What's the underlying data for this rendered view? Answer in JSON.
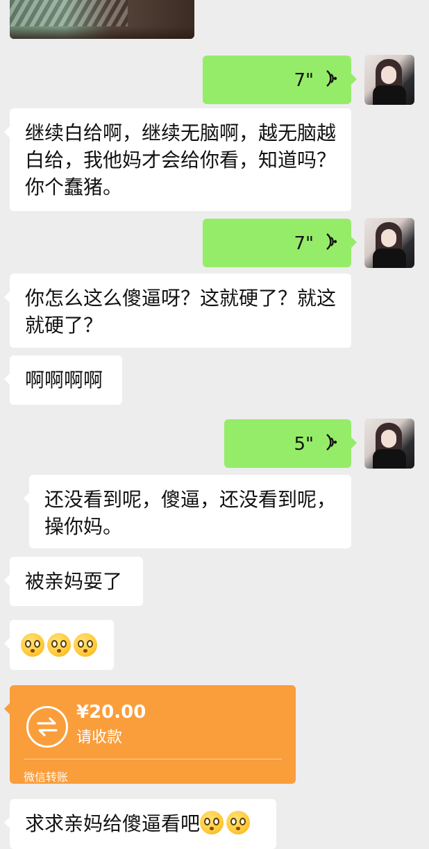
{
  "messages": [
    {
      "type": "voice",
      "side": "right",
      "duration": "7\""
    },
    {
      "type": "text",
      "side": "left",
      "text": "继续白给啊，继续无脑啊，越无脑越白给，我他妈才会给你看，知道吗？你个蠢猪。"
    },
    {
      "type": "voice",
      "side": "right",
      "duration": "7\""
    },
    {
      "type": "text",
      "side": "left",
      "text": "你怎么这么傻逼呀？这就硬了？就这就硬了？"
    },
    {
      "type": "text",
      "side": "left",
      "text": "啊啊啊啊"
    },
    {
      "type": "voice",
      "side": "right",
      "duration": "5\""
    },
    {
      "type": "text",
      "side": "left",
      "text": "还没看到呢，傻逼，还没看到呢，操你妈。"
    },
    {
      "type": "text",
      "side": "left",
      "text": "被亲妈耍了"
    },
    {
      "type": "emoji",
      "side": "left",
      "emojis": [
        "pleading-face",
        "pleading-face",
        "pleading-face"
      ]
    },
    {
      "type": "transfer",
      "side": "left",
      "amount": "¥20.00",
      "status": "请收款",
      "brand": "微信转账"
    },
    {
      "type": "text",
      "side": "left",
      "text": "求求亲妈给傻逼看吧",
      "emojis": [
        "pleading-face",
        "pleading-face"
      ]
    }
  ],
  "colors": {
    "background": "#ededed",
    "bubble_self": "#95ec69",
    "bubble_other": "#ffffff",
    "transfer": "#fa9d3b"
  }
}
